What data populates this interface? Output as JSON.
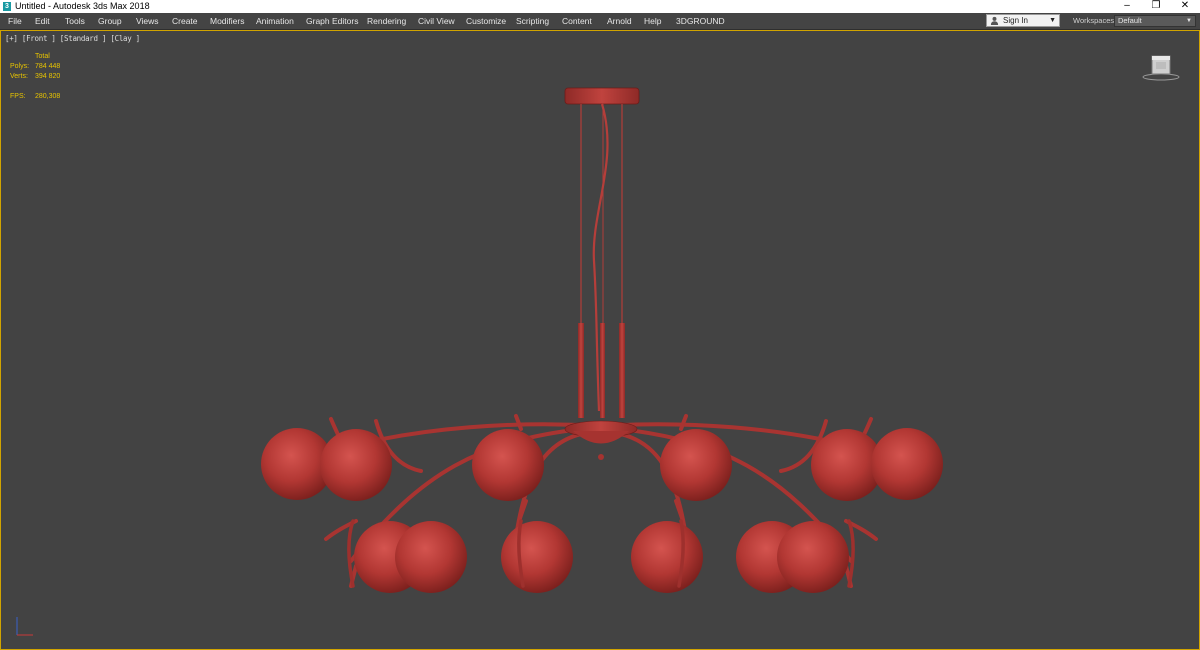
{
  "window": {
    "title": "Untitled - Autodesk 3ds Max 2018",
    "app_icon": "3",
    "controls": {
      "minimize": "–",
      "maximize": "❐",
      "close": "✕"
    }
  },
  "menu": {
    "items": [
      "File",
      "Edit",
      "Tools",
      "Group",
      "Views",
      "Create",
      "Modifiers",
      "Animation",
      "Graph Editors",
      "Rendering",
      "Civil View",
      "Customize",
      "Scripting",
      "Content",
      "Arnold",
      "Help",
      "3DGROUND"
    ]
  },
  "account": {
    "sign_in_label": "Sign In"
  },
  "workspace": {
    "label": "Workspaces:",
    "value": "Default"
  },
  "viewport": {
    "label": "[+] [Front ] [Standard ] [Clay ]",
    "stats": {
      "header": "Total",
      "polys_label": "Polys:",
      "polys_value": "784 448",
      "verts_label": "Verts:",
      "verts_value": "394 820",
      "fps_label": "FPS:",
      "fps_value": "280,308"
    },
    "border_color": "#d1a400",
    "model_color": "#b43a36"
  }
}
